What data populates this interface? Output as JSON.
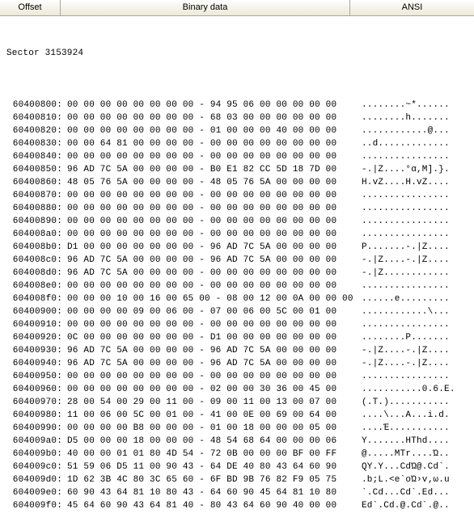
{
  "headers": {
    "offset": "Offset",
    "binary": "Binary data",
    "ansi": "ANSI"
  },
  "sector_label": "Sector 3153924",
  "rows": [
    {
      "offset": "60400800:",
      "bytes": "00 00 00 00 00 00 00 00 - 94 95 06 00 00 00 00 00",
      "ansi": "........~*......"
    },
    {
      "offset": "60400810:",
      "bytes": "00 00 00 00 00 00 00 00 - 68 03 00 00 00 00 00 00",
      "ansi": "........h......."
    },
    {
      "offset": "60400820:",
      "bytes": "00 00 00 00 00 00 00 00 - 01 00 00 00 40 00 00 00",
      "ansi": "............@..."
    },
    {
      "offset": "60400830:",
      "bytes": "00 00 64 81 00 00 00 00 - 00 00 00 00 00 00 00 00",
      "ansi": "..d............."
    },
    {
      "offset": "60400840:",
      "bytes": "00 00 00 00 00 00 00 00 - 00 00 00 00 00 00 00 00",
      "ansi": "................"
    },
    {
      "offset": "60400850:",
      "bytes": "96 AD 7C 5A 00 00 00 00 - B0 E1 82 CC 5D 18 7D 00",
      "ansi": "-.|Z....°α,Μ].}."
    },
    {
      "offset": "60400860:",
      "bytes": "48 05 76 5A 00 00 00 00 - 48 05 76 5A 00 00 00 00",
      "ansi": "H.vZ....H.vZ...."
    },
    {
      "offset": "60400870:",
      "bytes": "00 00 00 00 00 00 00 00 - 00 00 00 00 00 00 00 00",
      "ansi": "................"
    },
    {
      "offset": "60400880:",
      "bytes": "00 00 00 00 00 00 00 00 - 00 00 00 00 00 00 00 00",
      "ansi": "................"
    },
    {
      "offset": "60400890:",
      "bytes": "00 00 00 00 00 00 00 00 - 00 00 00 00 00 00 00 00",
      "ansi": "................"
    },
    {
      "offset": "604008a0:",
      "bytes": "00 00 00 00 00 00 00 00 - 00 00 00 00 00 00 00 00",
      "ansi": "................"
    },
    {
      "offset": "604008b0:",
      "bytes": "D1 00 00 00 00 00 00 00 - 96 AD 7C 5A 00 00 00 00",
      "ansi": "Ρ.......-.|Z...."
    },
    {
      "offset": "604008c0:",
      "bytes": "96 AD 7C 5A 00 00 00 00 - 96 AD 7C 5A 00 00 00 00",
      "ansi": "-.|Z....-.|Z...."
    },
    {
      "offset": "604008d0:",
      "bytes": "96 AD 7C 5A 00 00 00 00 - 00 00 00 00 00 00 00 00",
      "ansi": "-.|Z............"
    },
    {
      "offset": "604008e0:",
      "bytes": "00 00 00 00 00 00 00 00 - 00 00 00 00 00 00 00 00",
      "ansi": "................"
    },
    {
      "offset": "604008f0:",
      "bytes": "00 00 00 10 00 16 00 65 00 - 08 00 12 00 0A 00 00 00",
      "ansi": "......e........."
    },
    {
      "offset": "60400900:",
      "bytes": "00 00 00 00 09 00 06 00 - 07 00 06 00 5C 00 01 00",
      "ansi": "............\\..."
    },
    {
      "offset": "60400910:",
      "bytes": "00 00 00 00 00 00 00 00 - 00 00 00 00 00 00 00 00",
      "ansi": "................"
    },
    {
      "offset": "60400920:",
      "bytes": "0C 00 00 00 00 00 00 00 - D1 00 00 00 00 00 00 00",
      "ansi": "........Ρ......."
    },
    {
      "offset": "60400930:",
      "bytes": "96 AD 7C 5A 00 00 00 00 - 96 AD 7C 5A 00 00 00 00",
      "ansi": "-.|Z....-.|Z...."
    },
    {
      "offset": "60400940:",
      "bytes": "96 AD 7C 5A 00 00 00 00 - 96 AD 7C 5A 00 00 00 00",
      "ansi": "-.|Z....-.|Z...."
    },
    {
      "offset": "60400950:",
      "bytes": "00 00 00 00 00 00 00 00 - 00 00 00 00 00 00 00 00",
      "ansi": "................"
    },
    {
      "offset": "60400960:",
      "bytes": "00 00 00 00 00 00 00 00 - 02 00 00 30 36 00 45 00",
      "ansi": "...........0.6.E."
    },
    {
      "offset": "60400970:",
      "bytes": "28 00 54 00 29 00 11 00 - 09 00 11 00 13 00 07 00",
      "ansi": "(.T.)..........."
    },
    {
      "offset": "60400980:",
      "bytes": "11 00 06 00 5C 00 01 00 - 41 00 0E 00 69 00 64 00",
      "ansi": "....\\...A...i.d."
    },
    {
      "offset": "60400990:",
      "bytes": "00 00 00 00 B8 00 00 00 - 01 00 18 00 00 00 05 00",
      "ansi": "....Έ..........."
    },
    {
      "offset": "604009a0:",
      "bytes": "D5 00 00 00 18 00 00 00 - 48 54 68 64 00 00 00 06",
      "ansi": "Υ.......HThd...."
    },
    {
      "offset": "604009b0:",
      "bytes": "40 00 00 01 01 80 4D 54 - 72 0B 00 00 00 BF 00 FF",
      "ansi": "@.....MTr....Ώ.."
    },
    {
      "offset": "604009c0:",
      "bytes": "51 59 06 D5 11 00 90 43 - 64 DE 40 80 43 64 60 90",
      "ansi": "QY.Υ...CdΏ@.Cd`."
    },
    {
      "offset": "604009d0:",
      "bytes": "1D 62 3B 4C 80 3C 65 60 - 6F BD 9B 76 82 F9 05 75",
      "ansi": ".b;L.<e`oΏ›v‚ω.u"
    },
    {
      "offset": "604009e0:",
      "bytes": "60 90 43 64 81 10 80 43 - 64 60 90 45 64 81 10 80",
      "ansi": "`.Cd...Cd`.Ed..."
    },
    {
      "offset": "604009f0:",
      "bytes": "45 64 60 90 43 64 81 40 - 80 43 64 60 90 40 00 00",
      "ansi": "Ed`.Cd.@.Cd`.@.."
    }
  ]
}
